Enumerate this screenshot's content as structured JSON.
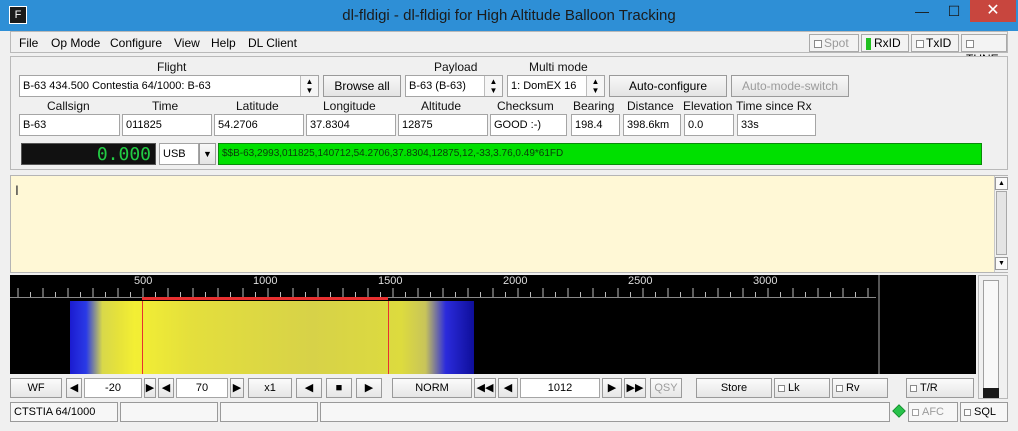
{
  "window": {
    "title": "dl-fldigi - dl-fldigi for High Altitude Balloon Tracking",
    "app_icon": "F",
    "minimize": "—",
    "maximize": "☐",
    "close": "✕"
  },
  "menu": {
    "items": [
      "File",
      "Op Mode",
      "Configure",
      "View",
      "Help",
      "DL Client"
    ],
    "toggles": {
      "spot": "Spot",
      "rxid": "RxID",
      "txid": "TxID",
      "tune": "TUNE"
    }
  },
  "flight": {
    "label": "Flight",
    "value": "B-63 434.500 Contestia 64/1000: B-63",
    "browse_all": "Browse all",
    "payload_label": "Payload",
    "payload_value": "B-63 (B-63)",
    "multimode_label": "Multi mode",
    "multimode_value": "1: DomEX 16",
    "auto_configure": "Auto-configure",
    "auto_mode_switch": "Auto-mode-switch"
  },
  "telemetry": {
    "callsign_label": "Callsign",
    "callsign": "B-63",
    "time_label": "Time",
    "time": "011825",
    "latitude_label": "Latitude",
    "latitude": "54.2706",
    "longitude_label": "Longitude",
    "longitude": "37.8304",
    "altitude_label": "Altitude",
    "altitude": "12875",
    "checksum_label": "Checksum",
    "checksum": "GOOD :-)",
    "bearing_label": "Bearing",
    "bearing": "198.4",
    "distance_label": "Distance",
    "distance": "398.6km",
    "elevation_label": "Elevation",
    "elevation": "0.0",
    "time_since_label": "Time since Rx",
    "time_since": "33s"
  },
  "rig": {
    "frequency": "0.000",
    "mode": "USB",
    "raw_sentence": "$$B-63,2993,011825,140712,54.2706,37.8304,12875,12,-33,3.76,0.49*61FD"
  },
  "rx_text": {
    "cursor": "I"
  },
  "waterfall": {
    "ticks": [
      "500",
      "1000",
      "1500",
      "2000",
      "2500",
      "3000"
    ],
    "colors": {
      "band_marker": "#e83030",
      "signal": "#e6e23a",
      "edge": "#1b1bd0"
    }
  },
  "controls": {
    "wf": "WF",
    "ref_level": "-20",
    "range": "70",
    "zoom": "x1",
    "speed": "NORM",
    "carrier": "1012",
    "qsy": "QSY",
    "store": "Store",
    "lk": "Lk",
    "rv": "Rv",
    "tr": "T/R"
  },
  "status": {
    "mode": "CTSTIA 64/1000",
    "afc": "AFC",
    "sql": "SQL"
  }
}
